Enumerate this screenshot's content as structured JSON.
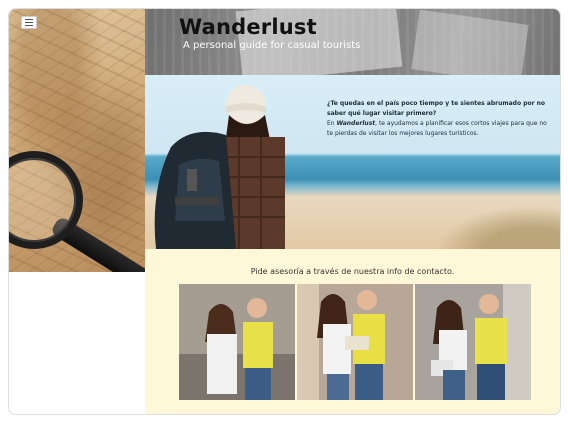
{
  "site": {
    "title": "Wanderlust",
    "subtitle": "A personal guide for casual tourists",
    "menu_icon": "hamburger-menu-icon"
  },
  "hero": {
    "question": "¿Te quedas en el país poco tiempo y te sientes abrumado por no saber qué lugar visitar primero?",
    "body_prefix": "En ",
    "brand": "Wanderlust",
    "body_suffix": ", te ayudamos a planificar esos cortos viajes para que no te pierdas de visitar los mejores lugares turísticos."
  },
  "contact": {
    "text": "Pide asesoría a través de nuestra info de contacto."
  },
  "colors": {
    "band_background": "#fff8d8",
    "title": "#111111",
    "subtitle": "#ffffff"
  }
}
